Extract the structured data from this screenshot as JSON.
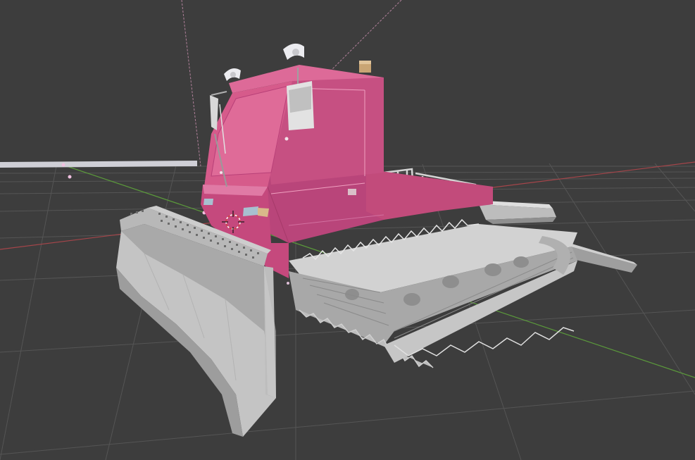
{
  "viewport": {
    "background": "#3d3d3d",
    "grid_color": "#555555",
    "x_axis_color": "#a5454a",
    "y_axis_color": "#5b9a3b",
    "origin_marker": "3d-cursor-icon"
  },
  "model": {
    "cab_color": "#d65b8b",
    "body_color": "#c24b7b",
    "metal_color": "#c9c9c9",
    "blade_color": "#b8b8b8",
    "light_color": "#e7e7ea",
    "beacon_color": "#c9a574"
  }
}
